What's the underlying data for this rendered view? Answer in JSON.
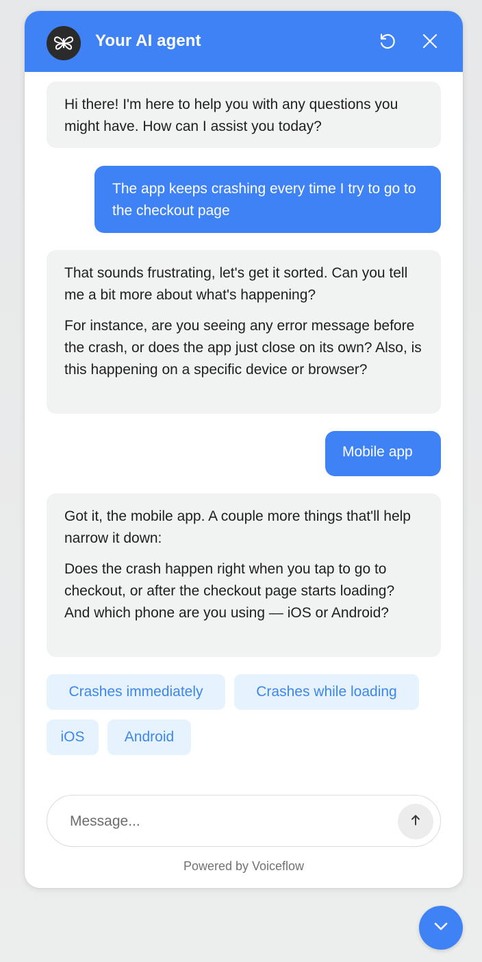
{
  "header": {
    "title": "Your AI agent",
    "avatar_icon": "butterfly-logo-icon",
    "refresh_icon": "refresh-icon",
    "close_icon": "close-icon"
  },
  "messages": [
    {
      "role": "agent",
      "paragraphs": [
        "Hi there! I'm here to help you with any questions you might have. How can I assist you today?"
      ]
    },
    {
      "role": "user",
      "paragraphs": [
        "The app keeps crashing every time I try to go to the checkout page"
      ]
    },
    {
      "role": "agent",
      "paragraphs": [
        "That sounds frustrating, let's get it sorted. Can you tell me a bit more about what's happening?",
        "For instance, are you seeing any error message before the crash, or does the app just close on its own? Also, is this happening on a specific device or browser?"
      ]
    },
    {
      "role": "user",
      "paragraphs": [
        "Mobile app"
      ]
    },
    {
      "role": "agent",
      "paragraphs": [
        "Got it, the mobile app. A couple more things that'll help narrow it down:",
        "Does the crash happen right when you tap to go to checkout, or after the checkout page starts loading? And which phone are you using — iOS or Android?"
      ]
    }
  ],
  "quick_replies": [
    "Crashes immediately",
    "Crashes while loading",
    "iOS",
    "Android"
  ],
  "composer": {
    "placeholder": "Message...",
    "send_icon": "arrow-up-icon"
  },
  "footer": {
    "powered_by": "Powered by Voiceflow"
  },
  "launcher": {
    "icon": "chevron-down-icon"
  },
  "colors": {
    "accent": "#3e82f6",
    "agent_bubble": "#f1f2f2",
    "chip_bg": "#e6f2fd",
    "chip_text": "#3d87ea"
  }
}
